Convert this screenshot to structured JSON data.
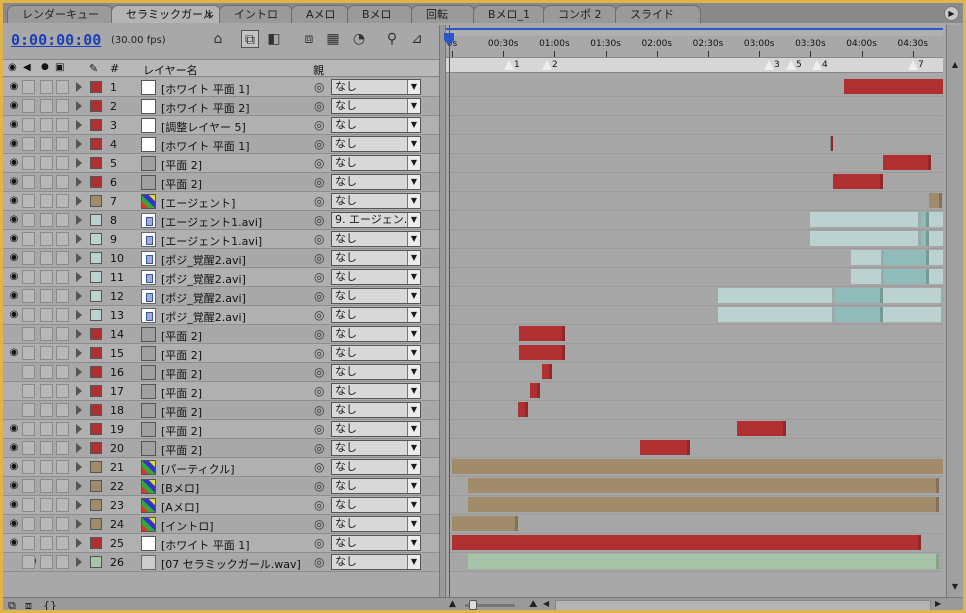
{
  "tabs": [
    {
      "label": "レンダーキュー",
      "active": false
    },
    {
      "label": "セラミックガール",
      "active": true,
      "close": "×"
    },
    {
      "label": "イントロ",
      "active": false
    },
    {
      "label": "Aメロ",
      "active": false
    },
    {
      "label": "Bメロ",
      "active": false
    },
    {
      "label": "回転",
      "active": false
    },
    {
      "label": "Bメロ_1",
      "active": false
    },
    {
      "label": "コンポ 2",
      "active": false
    },
    {
      "label": "スライド",
      "active": false
    }
  ],
  "toolbar": {
    "timecode": "0:00:00:00",
    "fps": "(30.00 fps)"
  },
  "columns": {
    "number": "#",
    "layer_name": "レイヤー名",
    "parent": "親"
  },
  "ruler": {
    "ticks": [
      "0s",
      "00:30s",
      "01:00s",
      "01:30s",
      "02:00s",
      "02:30s",
      "03:00s",
      "03:30s",
      "04:00s",
      "04:30s"
    ],
    "markers": [
      "1",
      "2",
      "3",
      "5",
      "4",
      "7"
    ]
  },
  "colors": {
    "red": "#b03032",
    "tan": "#a08c6a",
    "teal_light": "#bcd2d0",
    "teal": "#8fbcb8",
    "green_light": "#a8c4a8",
    "accent_blue": "#2e55c8",
    "cti_red": "#d02020"
  },
  "layers": [
    {
      "num": "1",
      "name": "[ホワイト 平面 1]",
      "parent": "なし",
      "label": "red",
      "thumb": "white",
      "eye": true,
      "bars": [
        {
          "start": 3.85,
          "end": 4.85,
          "color": "red"
        }
      ]
    },
    {
      "num": "2",
      "name": "[ホワイト 平面 2]",
      "parent": "なし",
      "label": "red",
      "thumb": "white",
      "eye": true,
      "bars": [
        {
          "start": 4.82,
          "end": 4.85,
          "color": "red"
        }
      ]
    },
    {
      "num": "3",
      "name": "[調整レイヤー 5]",
      "parent": "なし",
      "label": "red",
      "thumb": "white",
      "eye": true,
      "bars": [
        {
          "start": 4.81,
          "end": 4.85,
          "color": "red"
        }
      ]
    },
    {
      "num": "4",
      "name": "[ホワイト 平面 1]",
      "parent": "なし",
      "label": "red",
      "thumb": "white",
      "eye": true,
      "bars": [
        {
          "start": 3.72,
          "end": 3.74,
          "color": "red"
        }
      ]
    },
    {
      "num": "5",
      "name": "[平面 2]",
      "parent": "なし",
      "label": "red",
      "thumb": "gray",
      "eye": true,
      "bars": [
        {
          "start": 4.23,
          "end": 4.7,
          "color": "red"
        }
      ]
    },
    {
      "num": "6",
      "name": "[平面 2]",
      "parent": "なし",
      "label": "red",
      "thumb": "gray",
      "eye": true,
      "bars": [
        {
          "start": 3.74,
          "end": 4.23,
          "color": "red"
        }
      ]
    },
    {
      "num": "7",
      "name": "[エージェント]",
      "parent": "なし",
      "label": "tan",
      "thumb": "comp",
      "eye": true,
      "bars": [
        {
          "start": 4.68,
          "end": 4.8,
          "color": "tan"
        }
      ]
    },
    {
      "num": "8",
      "name": "[エージェント1.avi]",
      "parent": "9. エージェン…",
      "label": "teal_light",
      "thumb": "avi",
      "eye": true,
      "bars": [
        {
          "start": 3.52,
          "end": 4.6,
          "color": "teal_light"
        },
        {
          "start": 4.6,
          "end": 4.68,
          "color": "teal"
        },
        {
          "start": 4.68,
          "end": 4.9,
          "color": "teal_light"
        }
      ]
    },
    {
      "num": "9",
      "name": "[エージェント1.avi]",
      "parent": "なし",
      "label": "teal_light",
      "thumb": "avi",
      "eye": true,
      "bars": [
        {
          "start": 3.52,
          "end": 4.6,
          "color": "teal_light"
        },
        {
          "start": 4.6,
          "end": 4.68,
          "color": "teal"
        },
        {
          "start": 4.68,
          "end": 4.9,
          "color": "teal_light"
        }
      ]
    },
    {
      "num": "10",
      "name": "[ポジ_覚醒2.avi]",
      "parent": "なし",
      "label": "teal_light",
      "thumb": "avi",
      "eye": true,
      "bars": [
        {
          "start": 3.92,
          "end": 4.24,
          "color": "teal_light"
        },
        {
          "start": 4.24,
          "end": 4.68,
          "color": "teal"
        },
        {
          "start": 4.68,
          "end": 4.9,
          "color": "teal_light"
        }
      ]
    },
    {
      "num": "11",
      "name": "[ポジ_覚醒2.avi]",
      "parent": "なし",
      "label": "teal_light",
      "thumb": "avi",
      "eye": true,
      "bars": [
        {
          "start": 3.92,
          "end": 4.24,
          "color": "teal_light"
        },
        {
          "start": 4.24,
          "end": 4.68,
          "color": "teal"
        },
        {
          "start": 4.68,
          "end": 4.9,
          "color": "teal_light"
        }
      ]
    },
    {
      "num": "12",
      "name": "[ポジ_覚醒2.avi]",
      "parent": "なし",
      "label": "teal_light",
      "thumb": "avi",
      "eye": true,
      "bars": [
        {
          "start": 2.62,
          "end": 3.76,
          "color": "teal_light"
        },
        {
          "start": 3.76,
          "end": 4.23,
          "color": "teal"
        },
        {
          "start": 4.23,
          "end": 4.82,
          "color": "teal_light"
        }
      ]
    },
    {
      "num": "13",
      "name": "[ポジ_覚醒2.avi]",
      "parent": "なし",
      "label": "teal_light",
      "thumb": "avi",
      "eye": true,
      "bars": [
        {
          "start": 2.62,
          "end": 3.76,
          "color": "teal_light"
        },
        {
          "start": 3.76,
          "end": 4.23,
          "color": "teal"
        },
        {
          "start": 4.23,
          "end": 4.82,
          "color": "teal_light"
        }
      ]
    },
    {
      "num": "14",
      "name": "[平面 2]",
      "parent": "なし",
      "label": "red",
      "thumb": "gray",
      "eye": false,
      "bars": [
        {
          "start": 0.67,
          "end": 1.12,
          "color": "red"
        }
      ]
    },
    {
      "num": "15",
      "name": "[平面 2]",
      "parent": "なし",
      "label": "red",
      "thumb": "gray",
      "eye": true,
      "bars": [
        {
          "start": 0.67,
          "end": 1.12,
          "color": "red"
        }
      ]
    },
    {
      "num": "16",
      "name": "[平面 2]",
      "parent": "なし",
      "label": "red",
      "thumb": "gray",
      "eye": false,
      "bars": [
        {
          "start": 0.9,
          "end": 1.0,
          "color": "red"
        }
      ]
    },
    {
      "num": "17",
      "name": "[平面 2]",
      "parent": "なし",
      "label": "red",
      "thumb": "gray",
      "eye": false,
      "bars": [
        {
          "start": 0.78,
          "end": 0.88,
          "color": "red"
        }
      ]
    },
    {
      "num": "18",
      "name": "[平面 2]",
      "parent": "なし",
      "label": "red",
      "thumb": "gray",
      "eye": false,
      "bars": [
        {
          "start": 0.66,
          "end": 0.76,
          "color": "red"
        }
      ]
    },
    {
      "num": "19",
      "name": "[平面 2]",
      "parent": "なし",
      "label": "red",
      "thumb": "gray",
      "eye": true,
      "bars": [
        {
          "start": 2.8,
          "end": 3.28,
          "color": "red"
        }
      ]
    },
    {
      "num": "20",
      "name": "[平面 2]",
      "parent": "なし",
      "label": "red",
      "thumb": "gray",
      "eye": true,
      "bars": [
        {
          "start": 1.86,
          "end": 2.34,
          "color": "red"
        }
      ]
    },
    {
      "num": "21",
      "name": "[パーティクル]",
      "parent": "なし",
      "label": "tan",
      "thumb": "comp",
      "eye": true,
      "bars": [
        {
          "start": 0.02,
          "end": 4.86,
          "color": "tan"
        }
      ]
    },
    {
      "num": "22",
      "name": "[Bメロ]",
      "parent": "なし",
      "label": "tan",
      "thumb": "comp",
      "eye": true,
      "bars": [
        {
          "start": 0.18,
          "end": 4.78,
          "color": "tan"
        }
      ]
    },
    {
      "num": "23",
      "name": "[Aメロ]",
      "parent": "なし",
      "label": "tan",
      "thumb": "comp",
      "eye": true,
      "bars": [
        {
          "start": 0.18,
          "end": 4.78,
          "color": "tan"
        }
      ]
    },
    {
      "num": "24",
      "name": "[イントロ]",
      "parent": "なし",
      "label": "tan",
      "thumb": "comp",
      "eye": true,
      "bars": [
        {
          "start": 0.02,
          "end": 0.66,
          "color": "tan"
        }
      ]
    },
    {
      "num": "25",
      "name": "[ホワイト 平面 1]",
      "parent": "なし",
      "label": "red",
      "thumb": "white",
      "eye": true,
      "bars": [
        {
          "start": 0.02,
          "end": 4.6,
          "color": "red"
        }
      ]
    },
    {
      "num": "26",
      "name": "[07 セラミックガール.wav]",
      "parent": "なし",
      "label": "green_light",
      "thumb": "wav",
      "eye": false,
      "audio": true,
      "bars": [
        {
          "start": 0.18,
          "end": 4.78,
          "color": "green_light"
        }
      ]
    }
  ]
}
